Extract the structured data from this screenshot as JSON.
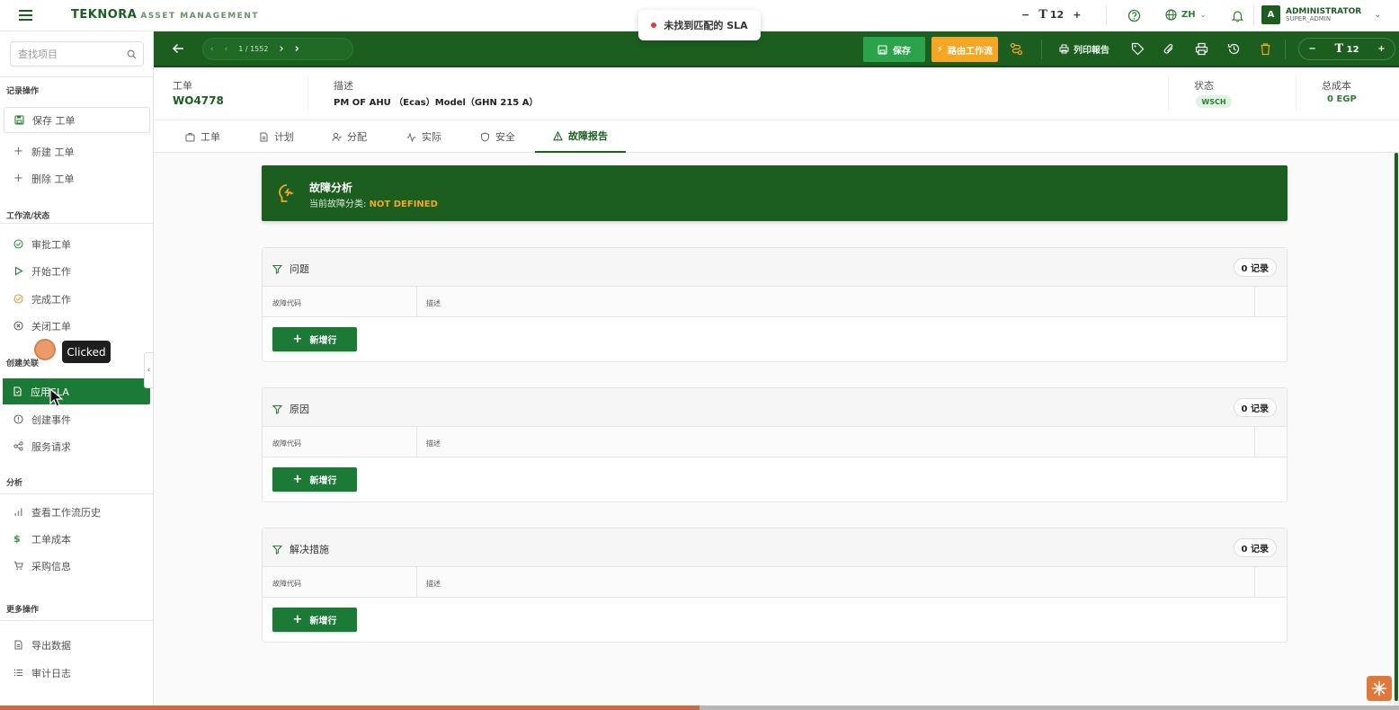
{
  "app": {
    "brand": "TEKNORA",
    "brand_sub": "ASSET MANAGEMENT"
  },
  "toast": {
    "message": "未找到匹配的 SLA"
  },
  "topbar": {
    "font_size": "12",
    "lang": "ZH",
    "user_name": "ADMINISTRATOR",
    "user_role": "SUPER_ADMIN",
    "avatar_letter": "A"
  },
  "sidebar": {
    "search_placeholder": "查找项目",
    "sections": {
      "record": "记录操作",
      "workflow": "工作流/状态",
      "create": "创建关联",
      "analysis": "分析",
      "more": "更多操作"
    },
    "items": {
      "save": "保存 工单",
      "new": "新建 工单",
      "delete": "删除 工单",
      "approve": "审批工单",
      "start": "开始工作",
      "complete": "完成工作",
      "close": "关闭工单",
      "apply_sla": "应用SLA",
      "create_event": "创建事件",
      "service_request": "服务请求",
      "workflow_history": "查看工作流历史",
      "wo_cost": "工单成本",
      "purchase": "采购信息",
      "export": "导出数据",
      "audit": "审计日志"
    }
  },
  "overlay": {
    "tooltip": "Clicked"
  },
  "toolbar": {
    "page_current": "1",
    "page_total": "1552",
    "save_label": "保存",
    "route_label": "路由工作流",
    "print_label": "列印報告",
    "font_size": "12"
  },
  "header": {
    "wo_label": "工单",
    "wo_value": "WO4778",
    "desc_label": "描述",
    "desc_value": "PM OF AHU （Ecas）Model（GHN 215 A）",
    "status_label": "状态",
    "status_value": "WSCH",
    "cost_label": "总成本",
    "cost_value": "0 EGP"
  },
  "tabs": [
    "工单",
    "计划",
    "分配",
    "实际",
    "安全",
    "故障报告"
  ],
  "banner": {
    "title": "故障分析",
    "subtitle_prefix": "当前故障分类: ",
    "subtitle_value": "NOT DEFINED"
  },
  "cards": [
    {
      "title": "问题",
      "count": "0 记录",
      "col1": "故障代码",
      "col2": "描述",
      "add": "新增行"
    },
    {
      "title": "原因",
      "count": "0 记录",
      "col1": "故障代码",
      "col2": "描述",
      "add": "新增行"
    },
    {
      "title": "解决措施",
      "count": "0 记录",
      "col1": "故障代码",
      "col2": "描述",
      "add": "新增行"
    }
  ],
  "colors": {
    "primary": "#1b5e20",
    "accent": "#f5a623",
    "button_green": "#2ba34a"
  },
  "progress": {
    "value": 0.5
  }
}
